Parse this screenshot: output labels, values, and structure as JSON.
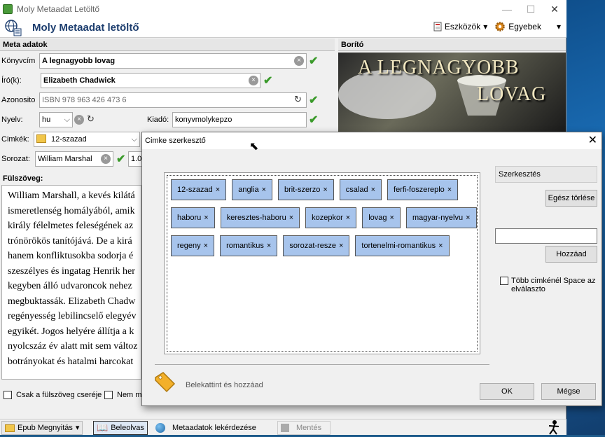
{
  "window": {
    "title": "Moly Metaadat Letöltő",
    "minimize": "—",
    "maximize": "☐",
    "close": "✕"
  },
  "header": {
    "title": "Moly Metaadat letöltő",
    "tools_label": "Eszközök",
    "tools_arrow": "▾",
    "other_label": "Egyebek",
    "other_arrow": "▾"
  },
  "meta": {
    "heading": "Meta adatok",
    "konyvcim_label": "Könyvcím",
    "konyvcim": "A legnagyobb lovag",
    "iro_label": "Író(k):",
    "iro": "Elizabeth Chadwick",
    "azonosito_label": "Azonosito",
    "azonosito": "ISBN 978 963 426 473 6",
    "nyelv_label": "Nyelv:",
    "nyelv": "hu",
    "kiado_label": "Kiadó:",
    "kiado": "konyvmolykepzo",
    "cimkek_label": "Cimkék:",
    "cimkek": "12-szazad",
    "sorozat_label": "Sorozat:",
    "sorozat": "William Marshal",
    "sorozat_num": "1.0"
  },
  "cover": {
    "heading": "Borító",
    "line1": "A LEGNAGYOBB",
    "line2": "LOVAG"
  },
  "blurb": {
    "heading": "Fülszöveg:",
    "lines": [
      "William Marshall, a kevés kilátá",
      "ismeretlenség homályából, amik",
      "király félelmetes feleségének az",
      "trónörökös tanítójává. De a kirá",
      "hanem konfliktusokba sodorja é",
      "szeszélyes és ingatag Henrik her",
      "kegyben álló udvaroncok nehez",
      "megbuktassák. Elizabeth Chadw",
      "regényesség lebilincselő elegyév",
      "egyikét. Jogos helyére állítja a k",
      "nyolcszáz év alatt mit sem változ",
      "botrányokat és hatalmi harcokat"
    ],
    "only_replace_label": "Csak a fülszöveg cseréje",
    "nem_label": "Nem mo"
  },
  "bottom": {
    "epub": "Epub Megnyitás",
    "beleolvas": "Beleolvas",
    "lekerdezes": "Metaadatok lekérdezése",
    "mentes": "Mentés"
  },
  "dialog": {
    "title": "Cimke szerkesztő",
    "close": "✕",
    "tags": [
      [
        "12-szazad",
        "anglia",
        "brit-szerzo",
        "csalad",
        "ferfi-foszereplo"
      ],
      [
        "haboru",
        "keresztes-haboru",
        "kozepkor",
        "lovag",
        "magyar-nyelvu"
      ],
      [
        "regeny",
        "romantikus",
        "sorozat-resze",
        "tortenelmi-romantikus"
      ]
    ],
    "tag_remove_glyph": "×",
    "szerkesztes_label": "Szerkesztés",
    "clear_all": "Egész törlése",
    "add": "Hozzáad",
    "multi_label": "Több cimkénél Space az elválaszto",
    "hint": "Belekattint és hozzáad",
    "ok": "OK",
    "cancel": "Mégse"
  }
}
